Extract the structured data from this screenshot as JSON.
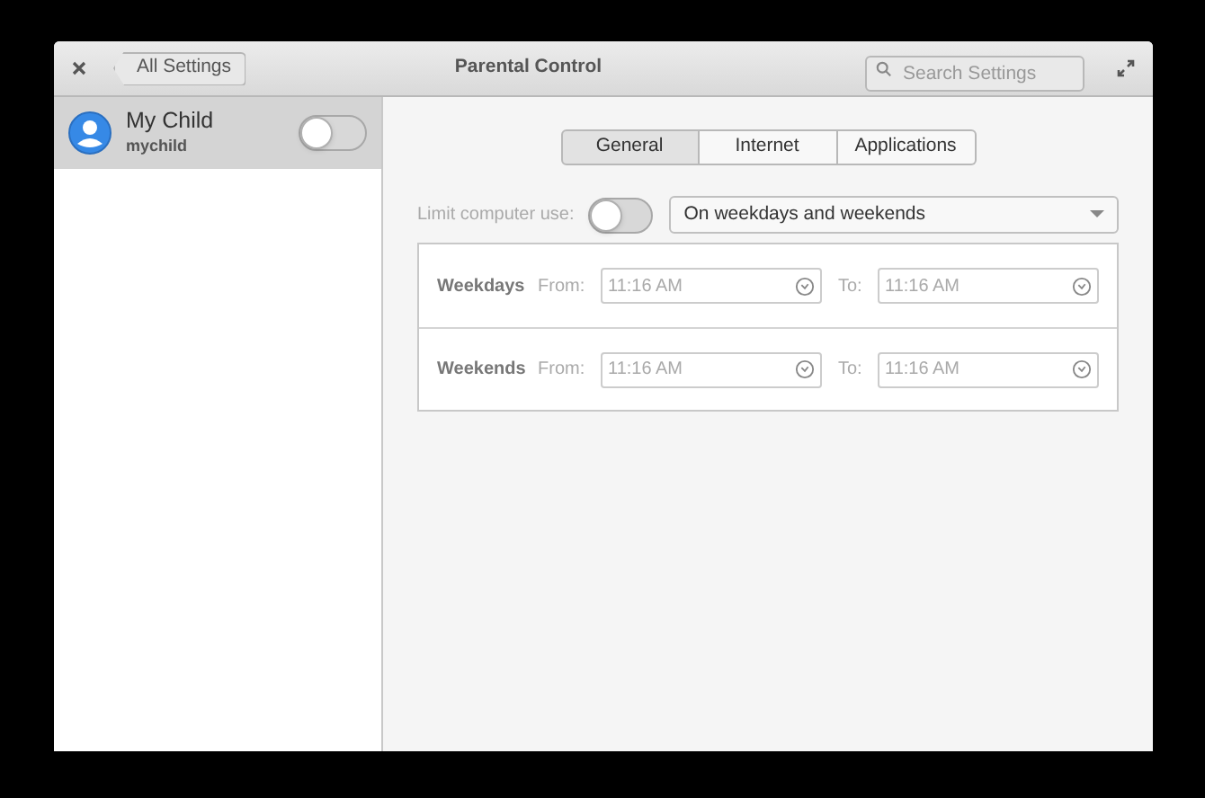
{
  "window": {
    "title": "Parental Control",
    "back": "All Settings",
    "search": {
      "placeholder": "Search Settings"
    }
  },
  "users": [
    {
      "name": "My Child",
      "login": "mychild",
      "selected": true,
      "on": false
    }
  ],
  "tabs": [
    {
      "label": "General",
      "selected": true
    },
    {
      "label": "Internet",
      "selected": false
    },
    {
      "label": "Applications",
      "selected": false
    }
  ],
  "limit": {
    "label": "Limit computer use:",
    "on": false,
    "schedule": "On weekdays and weekends",
    "rows": [
      {
        "day": "Weekdays",
        "from_label": "From:",
        "from": "11:16 AM",
        "to_label": "To:",
        "to": "11:16 AM"
      },
      {
        "day": "Weekends",
        "from_label": "From:",
        "from": "11:16 AM",
        "to_label": "To:",
        "to": "11:16 AM"
      }
    ]
  }
}
